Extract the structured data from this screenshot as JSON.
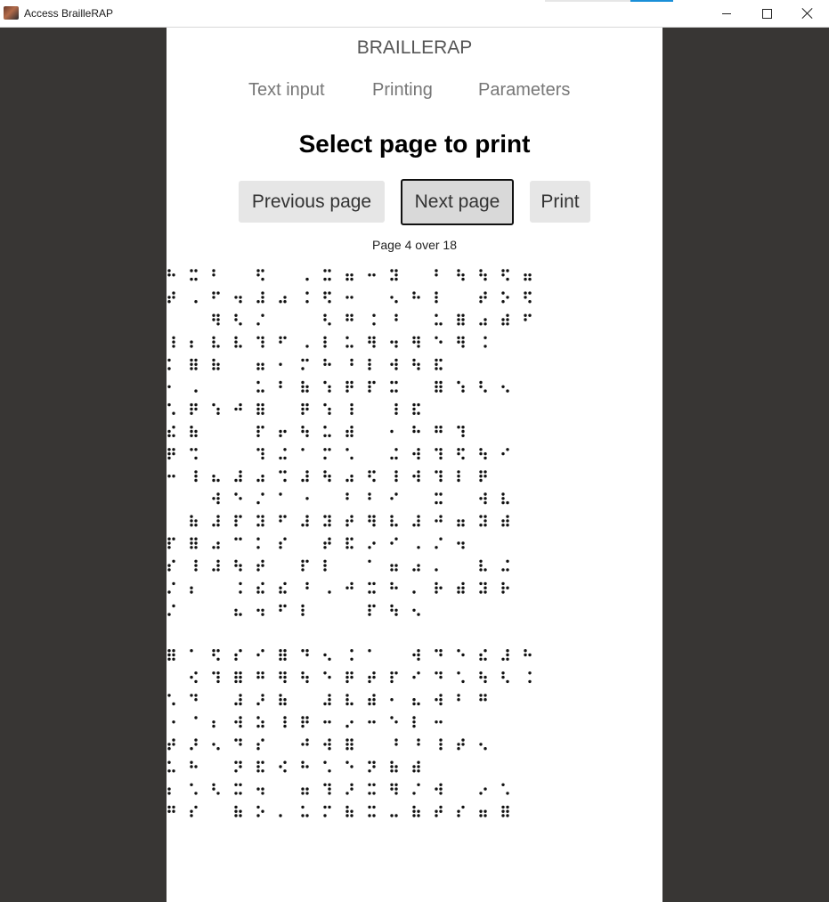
{
  "window": {
    "title": "Access BrailleRAP",
    "controls": {
      "minimize": "minimize-icon",
      "maximize": "maximize-icon",
      "close": "close-icon"
    }
  },
  "app": {
    "brand": "BRAILLERAP",
    "nav": [
      {
        "label": "Text input"
      },
      {
        "label": "Printing"
      },
      {
        "label": "Parameters"
      }
    ],
    "heading": "Select page to print",
    "buttons": {
      "previous": "Previous page",
      "next": "Next page",
      "print": "Print"
    },
    "page_info": "Page 4 over 18",
    "current_page": 4,
    "total_pages": 18
  },
  "preview": {
    "description_icon": "braille-page-preview",
    "line_count": 24
  },
  "colors": {
    "background": "#383634",
    "page": "#ffffff",
    "button": "#e6e6e6",
    "nav_text": "#777777",
    "accent": "#1a8fd8"
  }
}
